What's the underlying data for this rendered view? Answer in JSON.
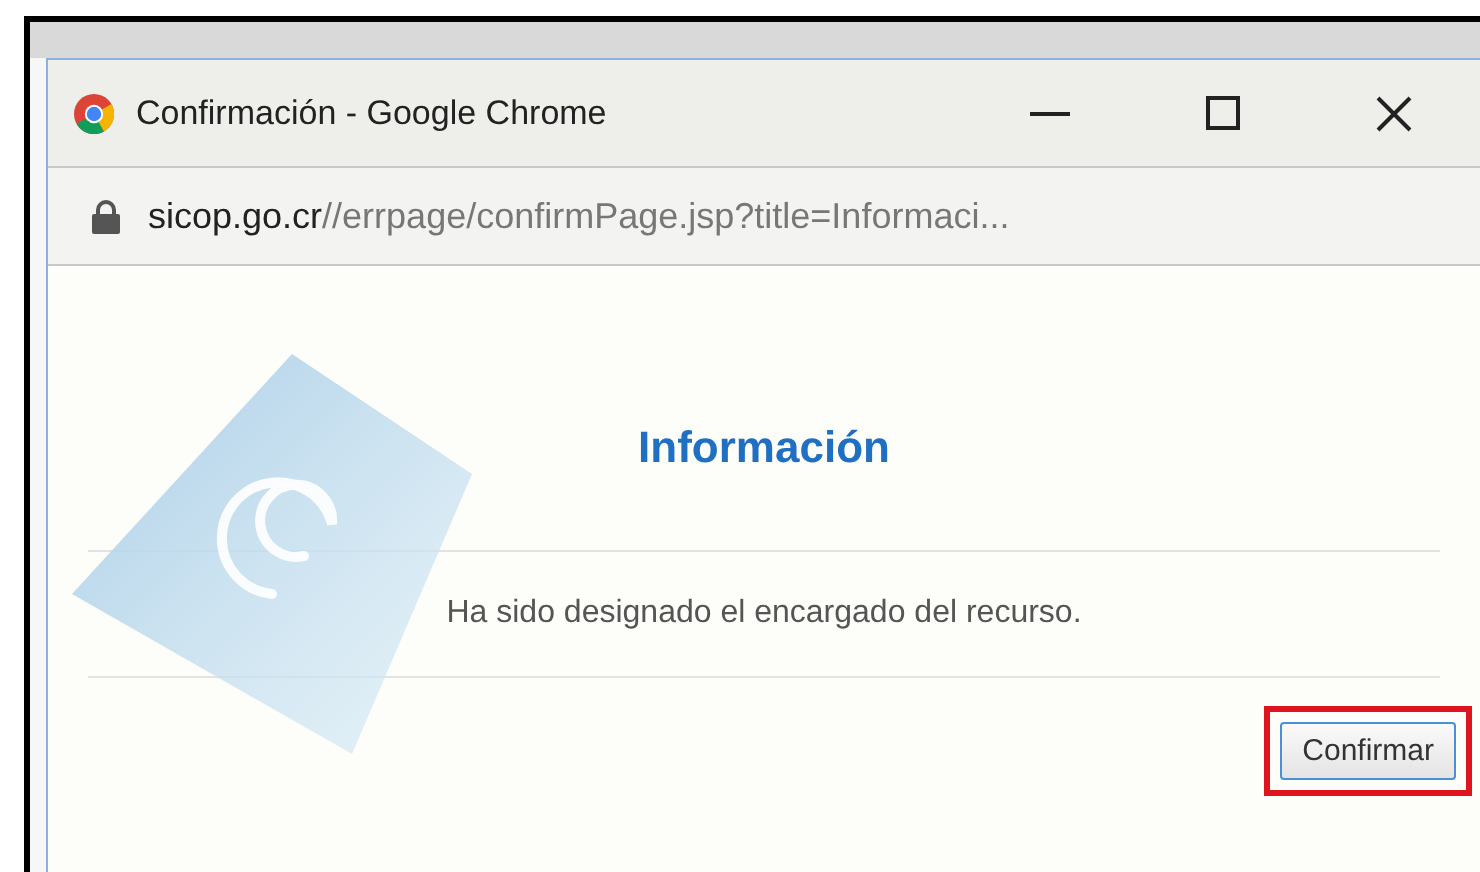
{
  "window": {
    "title": "Confirmación - Google Chrome"
  },
  "address_bar": {
    "host": "sicop.go.cr",
    "path": "//errpage/confirmPage.jsp?title=Informaci..."
  },
  "dialog": {
    "heading": "Información",
    "message": "Ha sido designado el encargado del recurso.",
    "button": {
      "label": "Confirmar",
      "highlighted": true
    }
  }
}
